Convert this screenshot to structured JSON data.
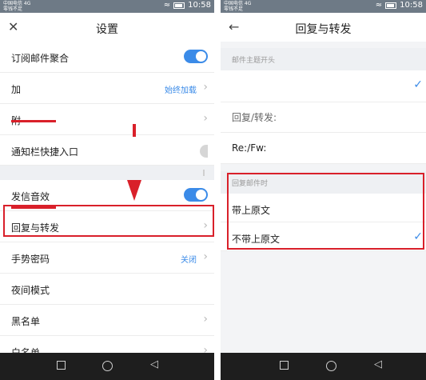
{
  "status_bar": {
    "carrier_line1": "中国电信 4G",
    "carrier_line2": "零钱不足",
    "time": "10:58"
  },
  "left": {
    "title": "设置",
    "rows": {
      "mail_aggregation": "订阅邮件聚合",
      "row2_label": "加",
      "row2_value": "始终加载",
      "row3_label": "附",
      "notification": "通知栏快捷入口",
      "send_sound": "发信音效",
      "reply_forward": "回复与转发",
      "gesture_password": "手势密码",
      "gesture_value": "关闭",
      "night_mode": "夜间模式",
      "blacklist": "黑名单",
      "whitelist": "白名单"
    }
  },
  "right": {
    "title": "回复与转发",
    "section_subject": "邮件主题开头",
    "row_reply_forward_partial": "回复/转发:",
    "row_re_fw": "Re:/Fw:",
    "section_reply": "回复邮件时",
    "row_with_original": "带上原文",
    "row_without_original": "不带上原文"
  },
  "colors": {
    "accent": "#3b8be8",
    "annotation_red": "#d9202a",
    "status_bar": "#6e7a86",
    "nav_bar": "#1e1e1e"
  }
}
